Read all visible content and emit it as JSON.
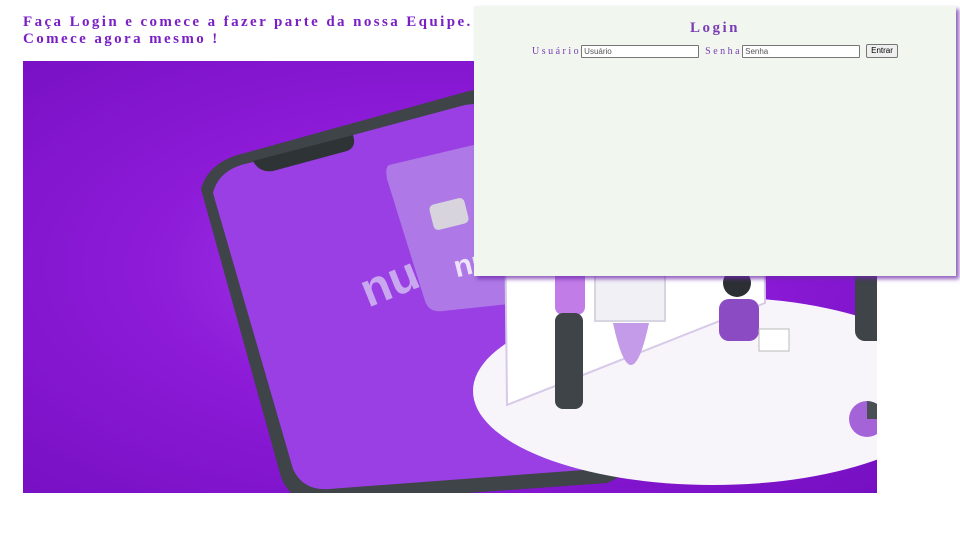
{
  "headline": {
    "line1": "Faça Login e comece a fazer parte da nossa Equipe.",
    "line2": "Comece agora mesmo !"
  },
  "hero": {
    "brand_text": "nu",
    "colors": {
      "background": "#8d1bd8",
      "accent": "#a563d8",
      "dark": "#3c4347"
    }
  },
  "login": {
    "title": "Login",
    "username_label": "Usuário",
    "username_placeholder": "Usuário",
    "password_label": "Senha",
    "password_placeholder": "Senha",
    "submit_label": "Entrar"
  }
}
